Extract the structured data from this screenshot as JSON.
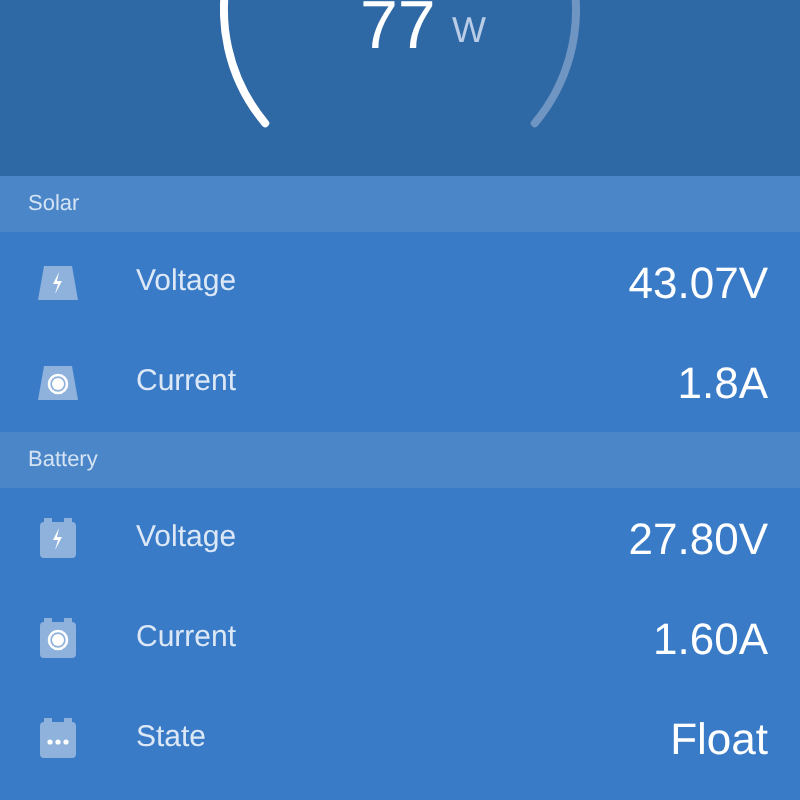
{
  "gauge": {
    "value": "77",
    "unit": "W"
  },
  "sections": [
    {
      "title": "Solar",
      "kind": "panel",
      "rows": [
        {
          "kind": "voltage",
          "label": "Voltage",
          "value": "43.07V"
        },
        {
          "kind": "current",
          "label": "Current",
          "value": "1.8A"
        }
      ]
    },
    {
      "title": "Battery",
      "kind": "battery",
      "rows": [
        {
          "kind": "voltage",
          "label": "Voltage",
          "value": "27.80V"
        },
        {
          "kind": "current",
          "label": "Current",
          "value": "1.60A"
        },
        {
          "kind": "state",
          "label": "State",
          "value": "Float"
        }
      ]
    }
  ]
}
